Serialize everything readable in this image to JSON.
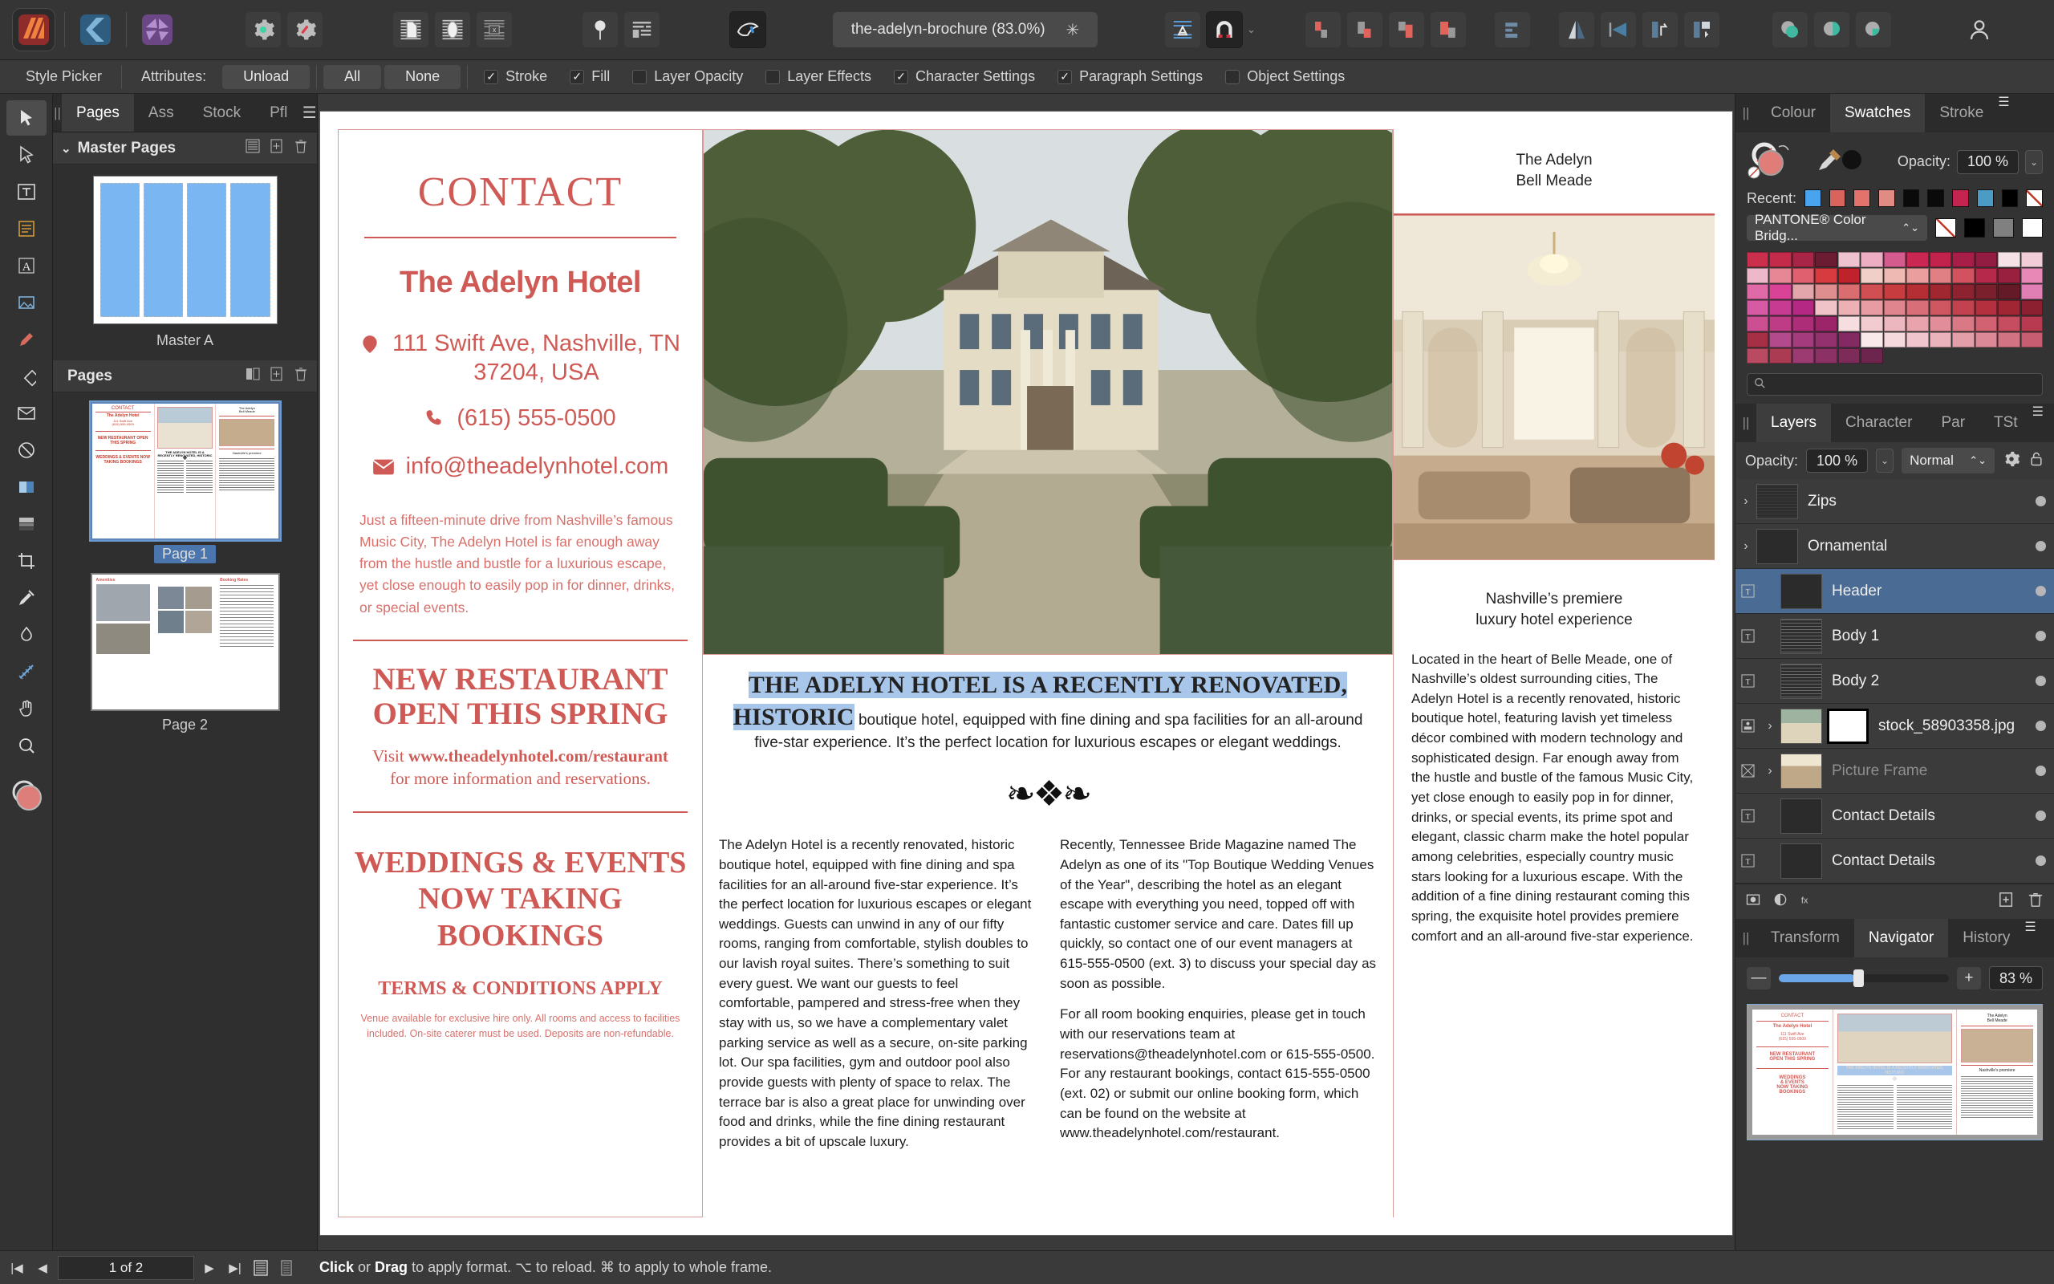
{
  "app": {
    "name": "Affinity Publisher",
    "icons": [
      "publisher-logo",
      "designer-logo",
      "photo-logo"
    ]
  },
  "toolbar": {
    "document_tab": {
      "title": "the-adelyn-brochure (83.0%)",
      "modified_marker": "✳"
    },
    "buttons": [
      {
        "name": "preferences-icon",
        "label": "Preferences"
      },
      {
        "name": "document-setup-icon",
        "label": "Document Setup"
      },
      {
        "name": "show-text-frame-icon",
        "label": "Text Frame"
      },
      {
        "name": "show-picture-frame-icon",
        "label": "Picture Frame"
      },
      {
        "name": "table-icon",
        "label": "Table"
      },
      {
        "name": "pin-icon",
        "label": "Pin"
      },
      {
        "name": "layout-icon",
        "label": "Layout"
      },
      {
        "name": "preflight-icon",
        "label": "Preflight"
      },
      {
        "name": "text-styles-icon",
        "label": "Text Styles"
      },
      {
        "name": "magnet-snapping-icon",
        "label": "Snapping"
      },
      {
        "name": "align-left-icon",
        "label": "Align Left"
      },
      {
        "name": "align-center-icon",
        "label": "Align Centre"
      },
      {
        "name": "align-right-icon",
        "label": "Align Right"
      },
      {
        "name": "align-distribute-icon",
        "label": "Distribute"
      },
      {
        "name": "arrange-icon",
        "label": "Arrange"
      },
      {
        "name": "flip-horizontal-icon",
        "label": "Flip Horizontal"
      },
      {
        "name": "flip-vertical-icon",
        "label": "Flip Vertical"
      },
      {
        "name": "rotate-left-icon",
        "label": "Rotate Left"
      },
      {
        "name": "rotate-right-icon",
        "label": "Rotate Right"
      },
      {
        "name": "boolean-add-icon",
        "label": "Add"
      },
      {
        "name": "boolean-subtract-icon",
        "label": "Subtract"
      },
      {
        "name": "boolean-intersect-icon",
        "label": "Intersect"
      },
      {
        "name": "account-icon",
        "label": "Account"
      }
    ]
  },
  "context_bar": {
    "tool_name": "Style Picker",
    "attributes_label": "Attributes:",
    "unload_label": "Unload",
    "all_label": "All",
    "none_label": "None",
    "checks": [
      {
        "label": "Stroke",
        "checked": true
      },
      {
        "label": "Fill",
        "checked": true
      },
      {
        "label": "Layer Opacity",
        "checked": false
      },
      {
        "label": "Layer Effects",
        "checked": false
      },
      {
        "label": "Character Settings",
        "checked": true
      },
      {
        "label": "Paragraph Settings",
        "checked": true
      },
      {
        "label": "Object Settings",
        "checked": false
      }
    ]
  },
  "tools": [
    {
      "name": "move-tool",
      "label": "Move Tool",
      "active": true
    },
    {
      "name": "node-tool",
      "label": "Node Tool",
      "active": false
    },
    {
      "name": "text-frame-tool",
      "label": "Frame Text Tool",
      "active": false
    },
    {
      "name": "artistic-text-tool",
      "label": "Artistic Text Tool",
      "active": false
    },
    {
      "name": "picture-frame-tool",
      "label": "Picture Frame Tool",
      "active": false
    },
    {
      "name": "pen-tool",
      "label": "Pen Tool",
      "active": false
    },
    {
      "name": "shape-tool",
      "label": "Shape Tool",
      "active": false
    },
    {
      "name": "envelope-tool",
      "label": "Envelope",
      "active": false
    },
    {
      "name": "erase-tool",
      "label": "Erase",
      "active": false
    },
    {
      "name": "gradient-tool",
      "label": "Fill Tool",
      "active": false
    },
    {
      "name": "transparency-tool",
      "label": "Transparency Tool",
      "active": false
    },
    {
      "name": "crop-tool",
      "label": "Crop Tool",
      "active": false
    },
    {
      "name": "style-picker-tool",
      "label": "Style Picker Tool",
      "active": false
    },
    {
      "name": "colour-picker-tool",
      "label": "Colour Picker Tool",
      "active": false
    },
    {
      "name": "measure-tool",
      "label": "Measure Tool",
      "active": false
    },
    {
      "name": "view-tool",
      "label": "View Tool",
      "active": false
    },
    {
      "name": "zoom-tool",
      "label": "Zoom Tool",
      "active": false
    }
  ],
  "left_panel": {
    "tabs": [
      {
        "label": "Pages",
        "active": true
      },
      {
        "label": "Ass",
        "active": false
      },
      {
        "label": "Stock",
        "active": false
      },
      {
        "label": "Pfl",
        "active": false
      }
    ],
    "master_section": {
      "title": "Master Pages",
      "thumb_label": "Master A"
    },
    "pages_section": {
      "title": "Pages",
      "pages": [
        {
          "label": "Page 1",
          "selected": true
        },
        {
          "label": "Page 2",
          "selected": false
        }
      ]
    }
  },
  "document": {
    "left_column": {
      "title": "CONTACT",
      "hotel_name": "The Adelyn Hotel",
      "address": "111 Swift Ave, Nashville, TN 37204, USA",
      "phone": "(615) 555-0500",
      "email": "info@theadelynhotel.com",
      "blurb": "Just a fifteen-minute drive from Nashville’s famous Music City, The Adelyn Hotel is far enough away from the hustle and bustle for a luxurious escape, yet close enough to easily pop in for dinner, drinks, or special events.",
      "restaurant_heading": "NEW RESTAURANT OPEN THIS SPRING",
      "restaurant_visit_pre": "Visit ",
      "restaurant_url": "www.theadelynhotel.com/restaurant",
      "restaurant_visit_post": " for more information and reservations.",
      "weddings_heading": "WEDDINGS & EVENTS NOW TAKING BOOKINGS",
      "terms": "TERMS & CONDITIONS APPLY",
      "fineprint": "Venue available for exclusive hire only. All rooms and access to facilities included. On-site caterer must be used. Deposits are non-refundable."
    },
    "middle_column": {
      "intro_selected": "THE ADELYN HOTEL IS A RECENTLY RENOVATED, HISTORIC",
      "intro_rest": " boutique hotel, equipped with fine dining and spa facilities for an all-around five-star experience. It’s the perfect location for luxurious escapes or elegant weddings.",
      "body_left": "The Adelyn Hotel is a recently renovated, historic boutique hotel, equipped with fine dining and spa facilities for an all-around five-star experience. It’s the perfect location for luxurious escapes or elegant weddings. Guests can unwind in any of our fifty rooms, ranging from comfortable, stylish doubles to our lavish royal suites. There’s something to suit every guest. We want our guests to feel comfortable, pampered and stress-free when they stay with us, so we have a complementary valet parking service as well as a secure, on-site parking lot. Our spa facilities, gym and outdoor pool also provide guests with plenty of space to relax. The terrace bar is also a great place for unwinding over food and drinks, while the fine dining restaurant provides a bit of upscale luxury.",
      "body_right_1": "Recently, Tennessee Bride Magazine named The Adelyn as one of its \"Top Boutique Wedding Venues of the Year\", describing the hotel as an elegant escape with everything you need, topped off with fantastic customer service and care. Dates fill up quickly, so contact one of our event managers at 615-555-0500 (ext. 3) to discuss your special day as soon as possible.",
      "body_right_2": "For all room booking enquiries, please get in touch with our reservations team at reservations@theadelynhotel.com or 615-555-0500. For any restaurant bookings, contact 615-555-0500 (ext. 02) or submit our online booking form, which can be found on the website at www.theadelynhotel.com/restaurant."
    },
    "right_column": {
      "brand_line_1": "The Adelyn",
      "brand_line_2": "Bell Meade",
      "caption_1": "Nashville’s premiere",
      "caption_2": "luxury hotel experience",
      "body": "Located in the heart of Belle Meade, one of Nashville’s oldest surrounding cities, The Adelyn Hotel is a recently renovated, historic boutique hotel, featuring lavish yet timeless décor combined with modern technology and sophisticated design. Far enough away from the hustle and bustle of the famous Music City, yet close enough to easily pop in for dinner, drinks, or special events, its prime spot and elegant, classic charm make the hotel popular among celebrities, especially country music stars looking for a luxurious escape. With the addition of a fine dining restaurant coming this spring, the exquisite hotel provides premiere comfort and an all-around five-star experience."
    }
  },
  "right_panel": {
    "colour_group": {
      "tabs": [
        {
          "label": "Colour",
          "active": false
        },
        {
          "label": "Swatches",
          "active": true
        },
        {
          "label": "Stroke",
          "active": false
        }
      ],
      "opacity_label": "Opacity:",
      "opacity_value": "100 %",
      "recent_label": "Recent:",
      "recent_colors": [
        "#4aa3ef",
        "#d9635d",
        "#e2736c",
        "#e08c85",
        "#0a0a0a",
        "#0a0a0a",
        "#c4244f",
        "#4c9bc4",
        "#000000",
        "none"
      ],
      "palette_name": "PANTONE® Color Bridg...",
      "quick_swatches": [
        "none",
        "#000000",
        "#808080",
        "#ffffff"
      ],
      "search_placeholder": "",
      "palette_rows": [
        [
          "#cb2f4e",
          "#c42b4a",
          "#a92548",
          "#6b1c33",
          "#efc2cf",
          "#edaec4",
          "#d45b8e",
          "#cb2753",
          "#c1234d",
          "#a71e48",
          "#921c42",
          "#f4e2e6",
          "#f0cdd7",
          "#edb8c9"
        ],
        [
          "#e78695",
          "#e06070",
          "#d73a3f",
          "#c0222b",
          "#f1cfc9",
          "#eeb9b3",
          "#ea9e9d",
          "#e07f84",
          "#d2525f",
          "#b6294a",
          "#99203f",
          "#e888b6",
          "#e06aa7",
          "#d94397"
        ],
        [
          "#e3a6aa",
          "#df8e90",
          "#d96d70",
          "#cf4f52",
          "#c73c3f",
          "#b52e33",
          "#a02730",
          "#8d2230",
          "#7a1f2c",
          "#651b27",
          "#df7fb4",
          "#d75ba4",
          "#c73c92",
          "#b52984"
        ],
        [
          "#f0c3c8",
          "#ecb0b5",
          "#e79ba2",
          "#e0858d",
          "#d86e78",
          "#cf5762",
          "#c3424f",
          "#b4303f",
          "#a12634",
          "#8c2030",
          "#cc4f92",
          "#bd3c85",
          "#ad2d78",
          "#9c2569"
        ],
        [
          "#f6dde0",
          "#f2cbd0",
          "#edb7bf",
          "#e8a3ad",
          "#e28e9a",
          "#db7886",
          "#d26172",
          "#c64c60",
          "#b83a50",
          "#a52f45",
          "#b34a8b",
          "#a33b7c",
          "#93306e",
          "#842a62"
        ],
        [
          "#f9e9ea",
          "#f5d9dc",
          "#f0c6cc",
          "#eab3bb",
          "#e39fa9",
          "#db8997",
          "#d27384",
          "#c75d71",
          "#ba4a61",
          "#ab3b53",
          "#9c3a72",
          "#8c3165",
          "#7d2b59",
          "#6e254d"
        ]
      ]
    },
    "layers_group": {
      "tabs": [
        {
          "label": "Layers",
          "active": true
        },
        {
          "label": "Character",
          "active": false
        },
        {
          "label": "Par",
          "active": false
        },
        {
          "label": "TSt",
          "active": false
        }
      ],
      "opacity_label": "Opacity:",
      "opacity_value": "100 %",
      "blend_mode": "Normal",
      "layers": [
        {
          "name": "Zips",
          "type": "group",
          "selected": false,
          "dim": false
        },
        {
          "name": "Ornamental",
          "type": "group",
          "selected": false,
          "dim": false
        },
        {
          "name": "Header",
          "type": "text",
          "selected": true,
          "dim": false
        },
        {
          "name": "Body 1",
          "type": "text",
          "selected": false,
          "dim": false
        },
        {
          "name": "Body 2",
          "type": "text",
          "selected": false,
          "dim": false
        },
        {
          "name": "stock_58903358.jpg",
          "type": "image",
          "selected": false,
          "dim": false
        },
        {
          "name": "Picture Frame",
          "type": "frame",
          "selected": false,
          "dim": true
        },
        {
          "name": "Contact Details",
          "type": "text",
          "selected": false,
          "dim": false
        },
        {
          "name": "Contact Details",
          "type": "text",
          "selected": false,
          "dim": false
        }
      ]
    },
    "navigator_group": {
      "tabs": [
        {
          "label": "Transform",
          "active": false
        },
        {
          "label": "Navigator",
          "active": true
        },
        {
          "label": "History",
          "active": false
        }
      ],
      "zoom_minus": "—",
      "zoom_plus": "+",
      "zoom_value": "83 %"
    }
  },
  "status_bar": {
    "page_indicator": "1 of 2",
    "hint_bold_1": "Click",
    "hint_mid_1": " or ",
    "hint_bold_2": "Drag",
    "hint_rest": " to apply format. ⌥ to reload. ⌘ to apply to whole frame."
  }
}
